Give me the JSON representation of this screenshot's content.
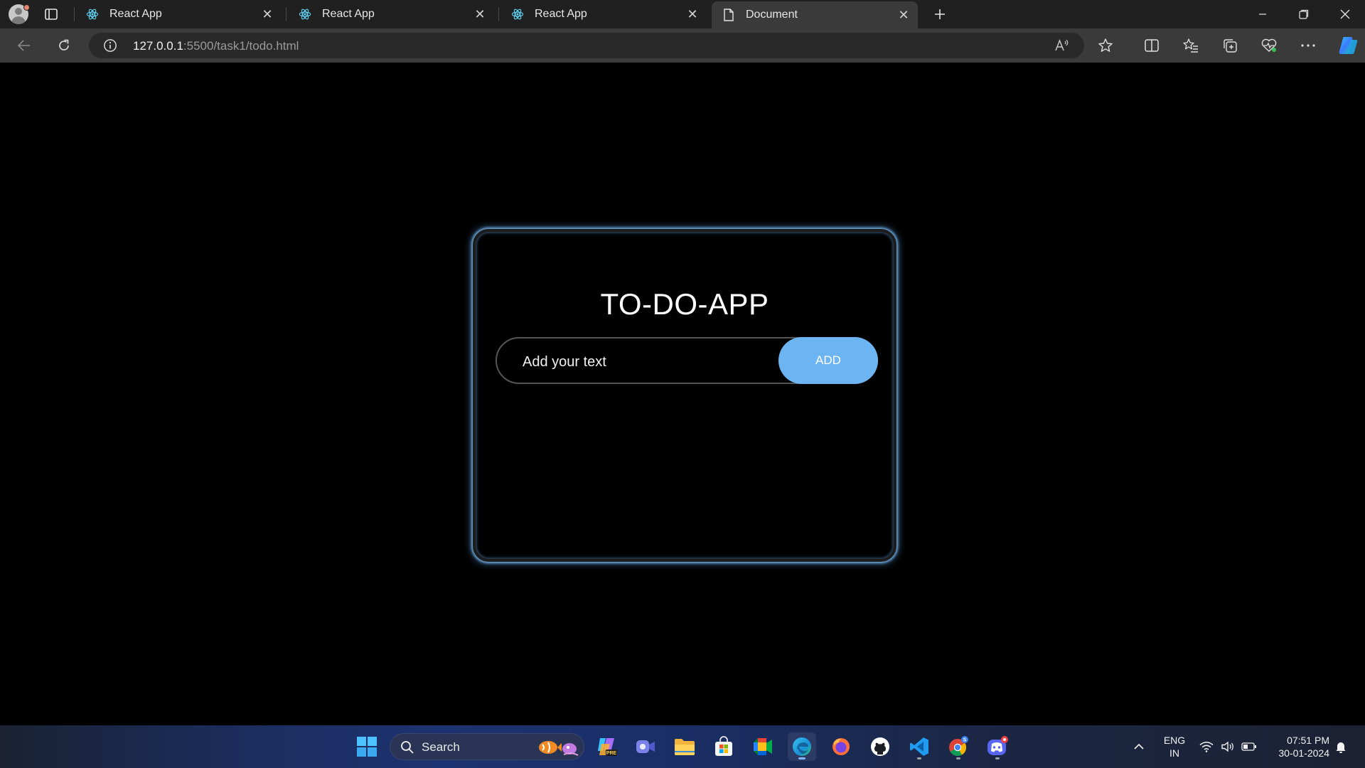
{
  "browser": {
    "tabs": [
      {
        "label": "React App",
        "icon": "react-icon",
        "active": false
      },
      {
        "label": "React App",
        "icon": "react-icon",
        "active": false
      },
      {
        "label": "React App",
        "icon": "react-icon",
        "active": false
      },
      {
        "label": "Document",
        "icon": "document-icon",
        "active": true
      }
    ],
    "url": {
      "host": "127.0.0.1",
      "path": ":5500/task1/todo.html"
    }
  },
  "app": {
    "title": "TO-DO-APP",
    "input_placeholder": "Add your text",
    "add_button": "ADD",
    "accent_color": "#6cb4f2",
    "glow_color": "#6aa6d8"
  },
  "taskbar": {
    "search_label": "Search",
    "language": {
      "line1": "ENG",
      "line2": "IN"
    },
    "time": "07:51 PM",
    "date": "30-01-2024",
    "pinned": [
      "windows-start-icon",
      "search-icon",
      "copilot-pre-icon",
      "teams-meet-icon",
      "file-explorer-icon",
      "microsoft-store-icon",
      "google-meet-icon",
      "edge-icon",
      "firefox-icon",
      "github-icon",
      "vscode-icon",
      "chrome-icon",
      "discord-icon"
    ]
  }
}
